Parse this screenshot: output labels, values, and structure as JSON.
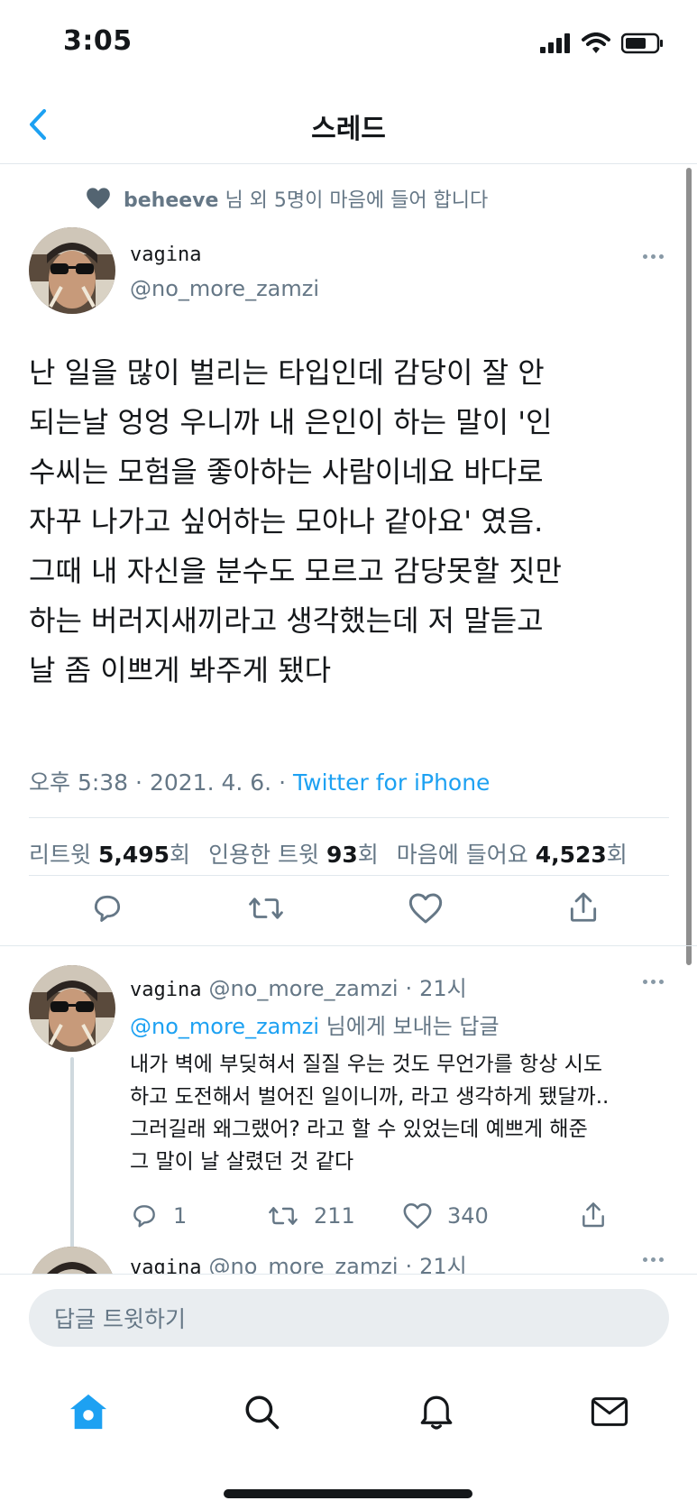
{
  "status_bar": {
    "time": "3:05"
  },
  "nav": {
    "title": "스레드"
  },
  "liked_by": {
    "name": "beheeve",
    "text": "님 외 5명이 마음에 들어 합니다"
  },
  "main_tweet": {
    "display_name": "vagina",
    "handle": "@no_more_zamzi",
    "text": "난 일을 많이 벌리는 타입인데 감당이 잘 안\n되는날 엉엉 우니까 내 은인이 하는 말이 '인\n수씨는 모험을 좋아하는 사람이네요 바다로\n자꾸 나가고 싶어하는 모아나 같아요' 였음.\n그때 내 자신을 분수도 모르고 감당못할 짓만\n하는 버러지새끼라고 생각했는데 저 말듣고\n날 좀 이쁘게 봐주게 됐다",
    "time": "오후 5:38",
    "date": "2021. 4. 6.",
    "source": "Twitter for iPhone",
    "stats": {
      "retweets_label": "리트윗",
      "retweets_value": "5,495",
      "quotes_label": "인용한 트윗",
      "quotes_value": "93",
      "likes_label": "마음에 들어요",
      "likes_value": "4,523",
      "unit": "회"
    }
  },
  "replies": [
    {
      "display_name": "vagina",
      "handle": "@no_more_zamzi",
      "time": "21시",
      "reply_to_handle": "@no_more_zamzi",
      "reply_to_text": "님에게 보내는 답글",
      "text": "내가 벽에 부딪혀서 질질 우는 것도 무언가를 항상 시도\n하고 도전해서 벌어진 일이니까, 라고 생각하게 됐달까..\n그러길래 왜그랬어? 라고 할 수 있었는데 예쁘게 해준\n그 말이 날 살렸던 것 같다",
      "reply_count": "1",
      "retweet_count": "211",
      "like_count": "340"
    },
    {
      "display_name": "vagina",
      "handle": "@no_more_zamzi",
      "time": "21시"
    }
  ],
  "compose": {
    "placeholder": "답글 트윗하기"
  },
  "icons": {
    "back": "chevron-left-icon",
    "reply": "speech-bubble-icon",
    "retweet": "retweet-icon",
    "like": "heart-icon",
    "share": "share-icon",
    "home": "home-icon",
    "search": "search-icon",
    "notifications": "bell-icon",
    "messages": "mail-icon"
  },
  "colors": {
    "accent": "#1da1f2",
    "text": "#14171a",
    "secondary": "#657786"
  }
}
